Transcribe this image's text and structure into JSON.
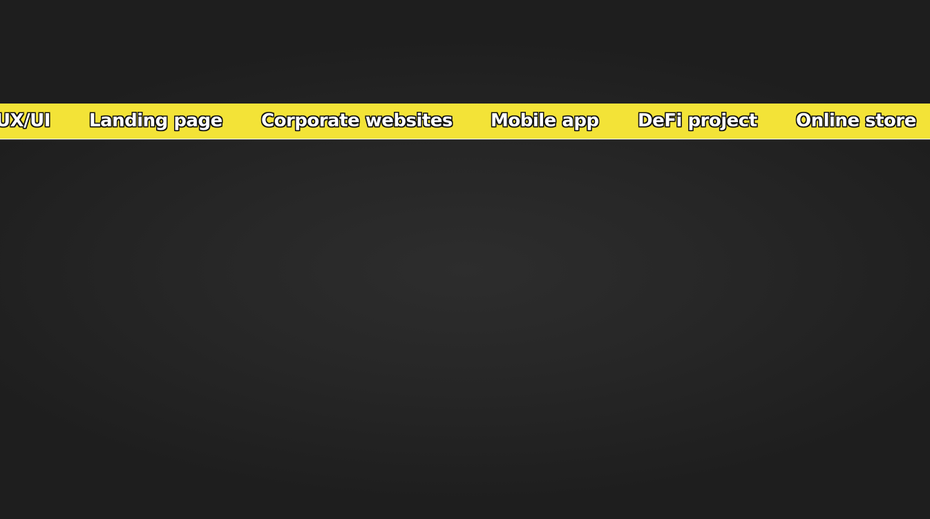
{
  "ticker": {
    "items": [
      "UX/UI",
      "Landing page",
      "Corporate websites",
      "Mobile app",
      "DeFi project",
      "Online store"
    ]
  },
  "colors": {
    "background": "#1e1e1e",
    "band": "#f3e337",
    "text": "#ffffff",
    "outline": "#111111"
  }
}
